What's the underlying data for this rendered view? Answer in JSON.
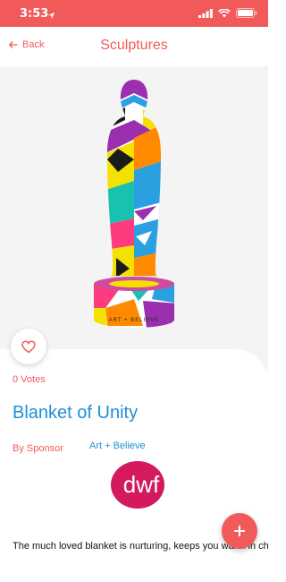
{
  "status_bar": {
    "time": "3:53"
  },
  "nav": {
    "back_label": "Back",
    "title": "Sculptures"
  },
  "hero": {
    "base_text": "ART + BELIEVE"
  },
  "item": {
    "votes": "0 Votes",
    "title": "Blanket of Unity",
    "by_label": "By Sponsor",
    "artist": "Art + Believe",
    "sponsor_logo_text": "dwf",
    "description": "The much loved blanket is nurturing, keeps you warm in cheerful colours and patterns of the spirit of"
  },
  "colors": {
    "accent": "#f25a5a",
    "link": "#1e90d6",
    "logo": "#d4195e"
  }
}
